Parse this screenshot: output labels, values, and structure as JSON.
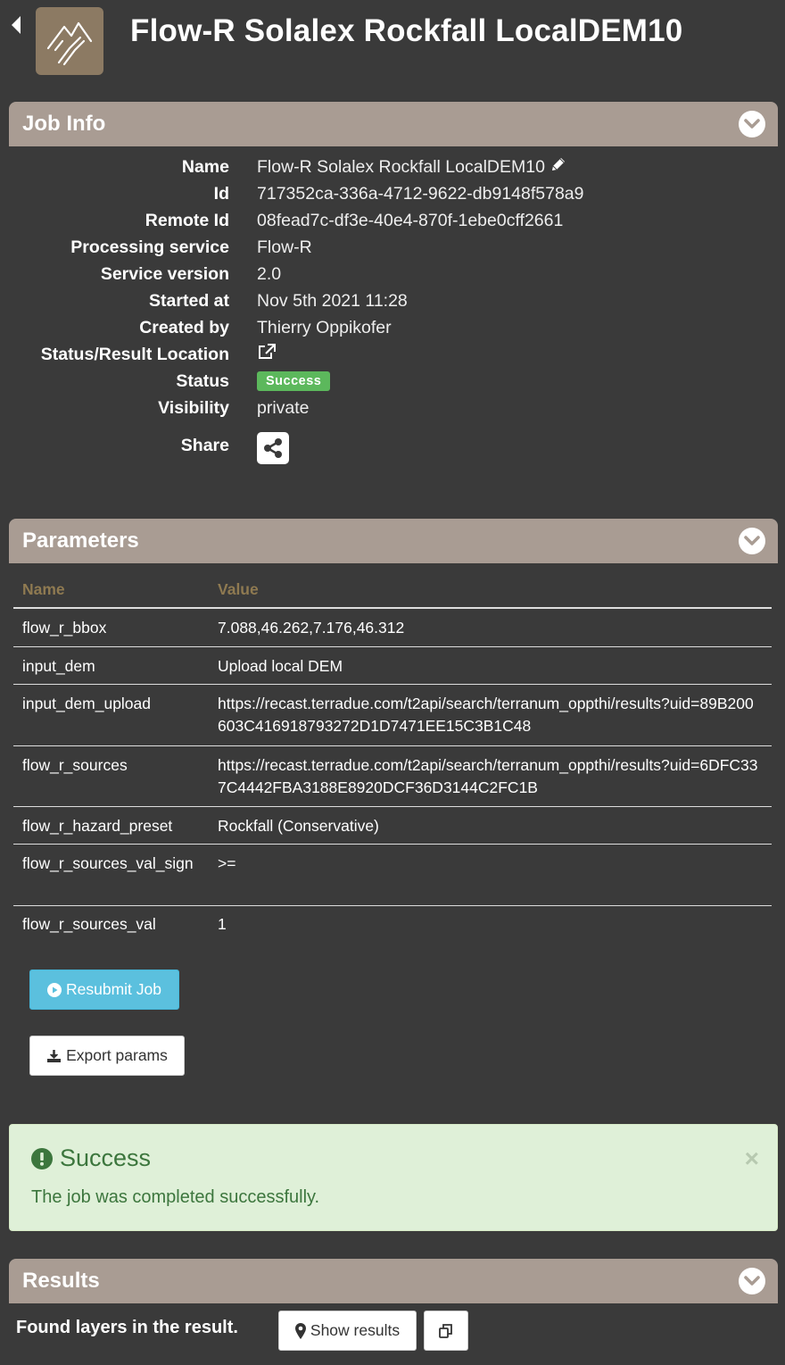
{
  "header": {
    "title": "Flow-R Solalex Rockfall LocalDEM10",
    "back_icon": "caret-left-icon",
    "logo_icon": "mountain-logo-icon"
  },
  "job_info": {
    "panel_title": "Job Info",
    "rows": [
      {
        "label": "Name",
        "value": "Flow-R Solalex Rockfall LocalDEM10"
      },
      {
        "label": "Id",
        "value": "717352ca-336a-4712-9622-db9148f578a9"
      },
      {
        "label": "Remote Id",
        "value": "08fead7c-df3e-40e4-870f-1ebe0cff2661"
      },
      {
        "label": "Processing service",
        "value": "Flow-R"
      },
      {
        "label": "Service version",
        "value": "2.0"
      },
      {
        "label": "Started at",
        "value": "Nov 5th 2021 11:28"
      },
      {
        "label": "Created by",
        "value": "Thierry Oppikofer"
      },
      {
        "label": "Status/Result Location",
        "value": ""
      },
      {
        "label": "Status",
        "value": "Success"
      },
      {
        "label": "Visibility",
        "value": "private"
      },
      {
        "label": "Share",
        "value": ""
      }
    ],
    "status_color": "#5cb85c"
  },
  "parameters": {
    "panel_title": "Parameters",
    "col_name": "Name",
    "col_value": "Value",
    "rows": [
      {
        "name": "flow_r_bbox",
        "value": "7.088,46.262,7.176,46.312"
      },
      {
        "name": "input_dem",
        "value": "Upload local DEM"
      },
      {
        "name": "input_dem_upload",
        "value": "https://recast.terradue.com/t2api/search/terranum_oppthi/results?uid=89B200603C416918793272D1D7471EE15C3B1C48"
      },
      {
        "name": "flow_r_sources",
        "value": "https://recast.terradue.com/t2api/search/terranum_oppthi/results?uid=6DFC337C4442FBA3188E8920DCF36D3144C2FC1B"
      },
      {
        "name": "flow_r_hazard_preset",
        "value": "Rockfall (Conservative)"
      },
      {
        "name": "flow_r_sources_val_sign",
        "value": ">="
      },
      {
        "name": "flow_r_sources_val",
        "value": "1"
      }
    ],
    "resubmit_label": "Resubmit Job",
    "export_label": "Export params"
  },
  "alert": {
    "title": "Success",
    "message": "The job was completed successfully.",
    "close": "×"
  },
  "results": {
    "panel_title": "Results",
    "text": "Found layers in the result.",
    "show_label": "Show results"
  },
  "colors": {
    "background": "#3a3a3a",
    "panel_header": "#a99c93",
    "accent_brown": "#8f7a51",
    "info_button": "#5bc0de",
    "success_bg": "#dff0d8",
    "success_text": "#3c763d"
  }
}
